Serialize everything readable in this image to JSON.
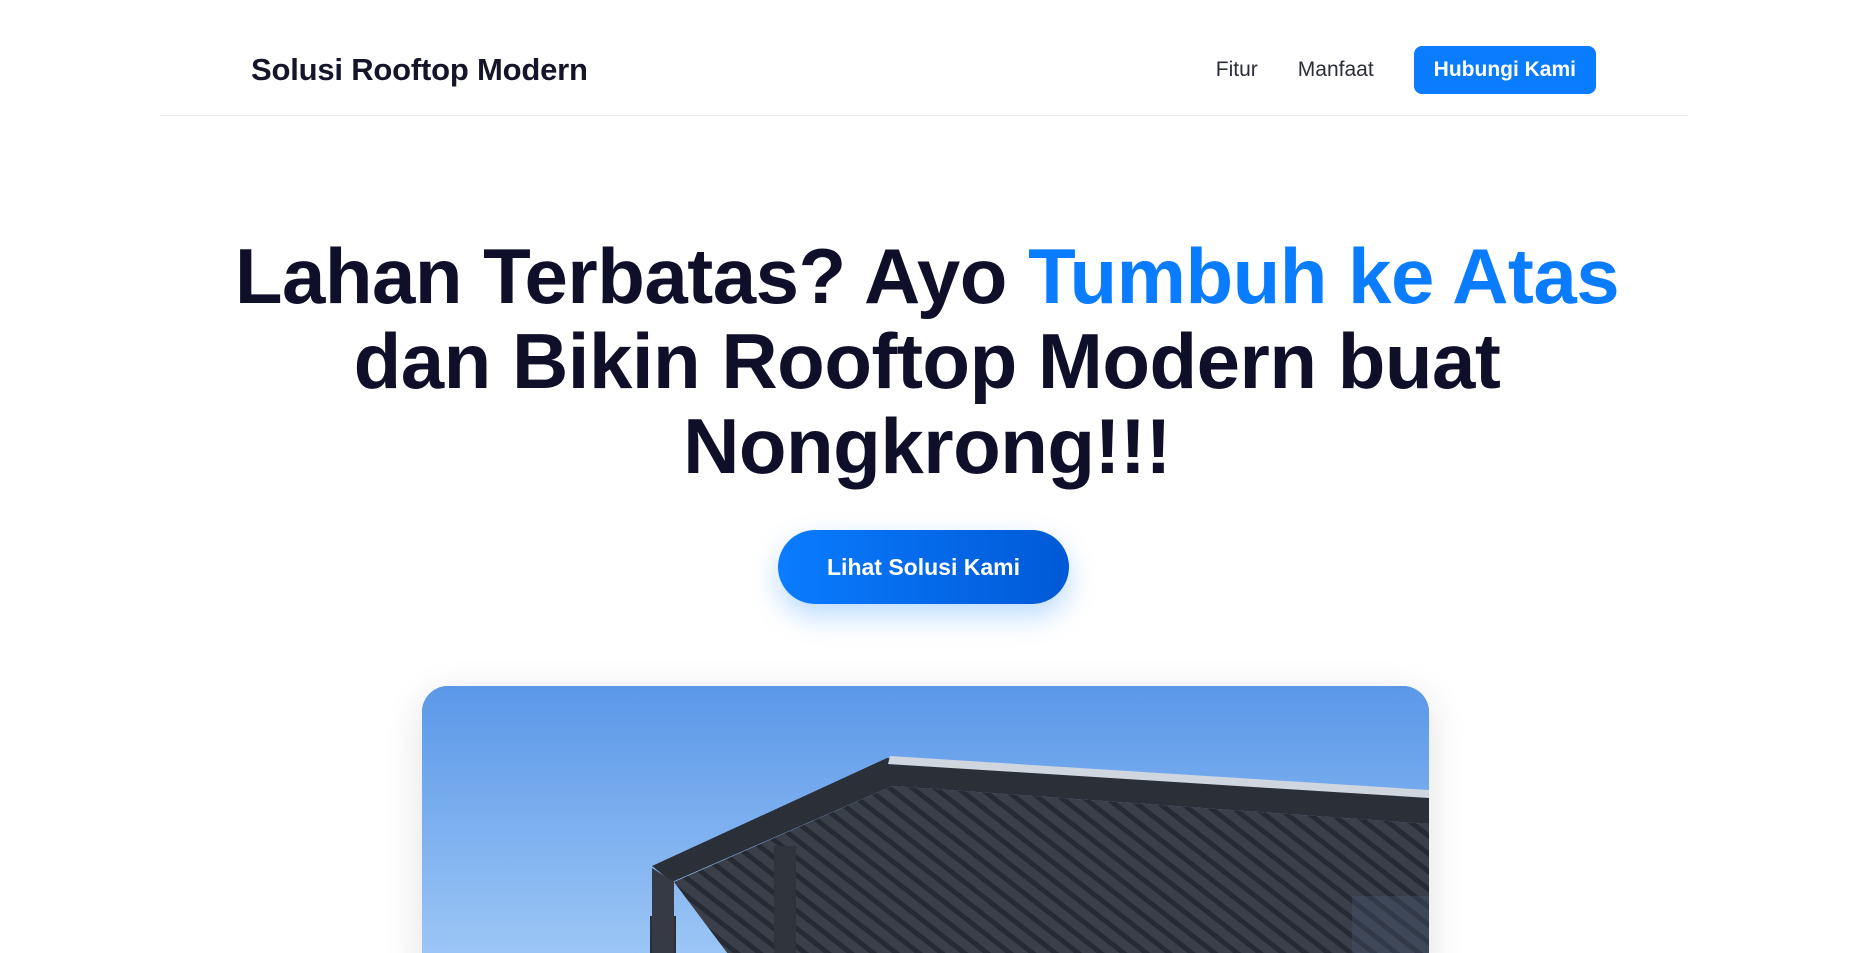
{
  "header": {
    "brand": "Solusi Rooftop Modern",
    "nav": [
      {
        "label": "Fitur"
      },
      {
        "label": "Manfaat"
      }
    ],
    "cta_label": "Hubungi Kami"
  },
  "hero": {
    "title_part1": "Lahan Terbatas? Ayo ",
    "title_accent": "Tumbuh ke Atas",
    "title_part2": " dan Bikin Rooftop Modern buat Nongkrong!!!",
    "cta_label": "Lihat Solusi Kami"
  },
  "colors": {
    "accent": "#0a7cff",
    "text_dark": "#0f0f2a",
    "button_text": "#ffffff"
  }
}
